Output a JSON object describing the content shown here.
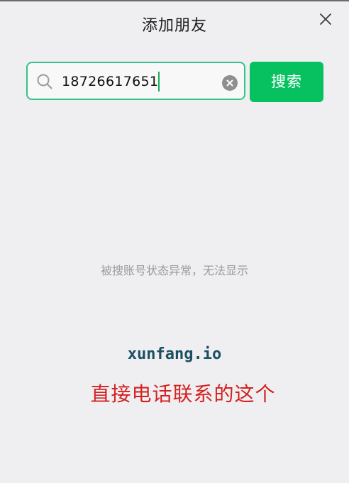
{
  "dialog": {
    "title": "添加朋友"
  },
  "search": {
    "value": "18726617651",
    "button_label": "搜索"
  },
  "result": {
    "message": "被搜账号状态异常，无法显示"
  },
  "overlay": {
    "watermark": "xunfang.io",
    "annotation": "直接电话联系的这个"
  },
  "icons": {
    "close": "close-icon",
    "search": "search-icon",
    "clear": "clear-icon"
  },
  "colors": {
    "accent": "#07c160",
    "focus_border": "#35c289",
    "annotation": "#d42020",
    "watermark": "#1d4f63"
  }
}
